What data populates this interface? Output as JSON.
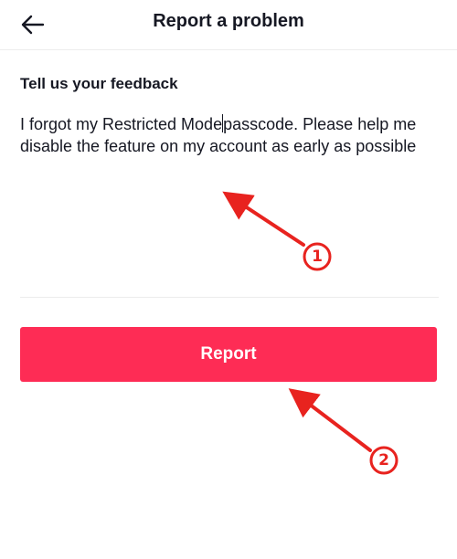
{
  "header": {
    "title": "Report a problem",
    "back_icon": "arrow-left-icon"
  },
  "feedback": {
    "heading": "Tell us your feedback",
    "text_before_caret": "I forgot my Restricted Mode",
    "text_after_caret": "passcode. Please help me disable the feature on my account as early as possible"
  },
  "actions": {
    "report_label": "Report"
  },
  "annotations": {
    "markers": [
      "1",
      "2"
    ],
    "color": "#e8231f"
  },
  "colors": {
    "accent": "#fe2c55",
    "text": "#161823",
    "divider": "#ececec"
  }
}
